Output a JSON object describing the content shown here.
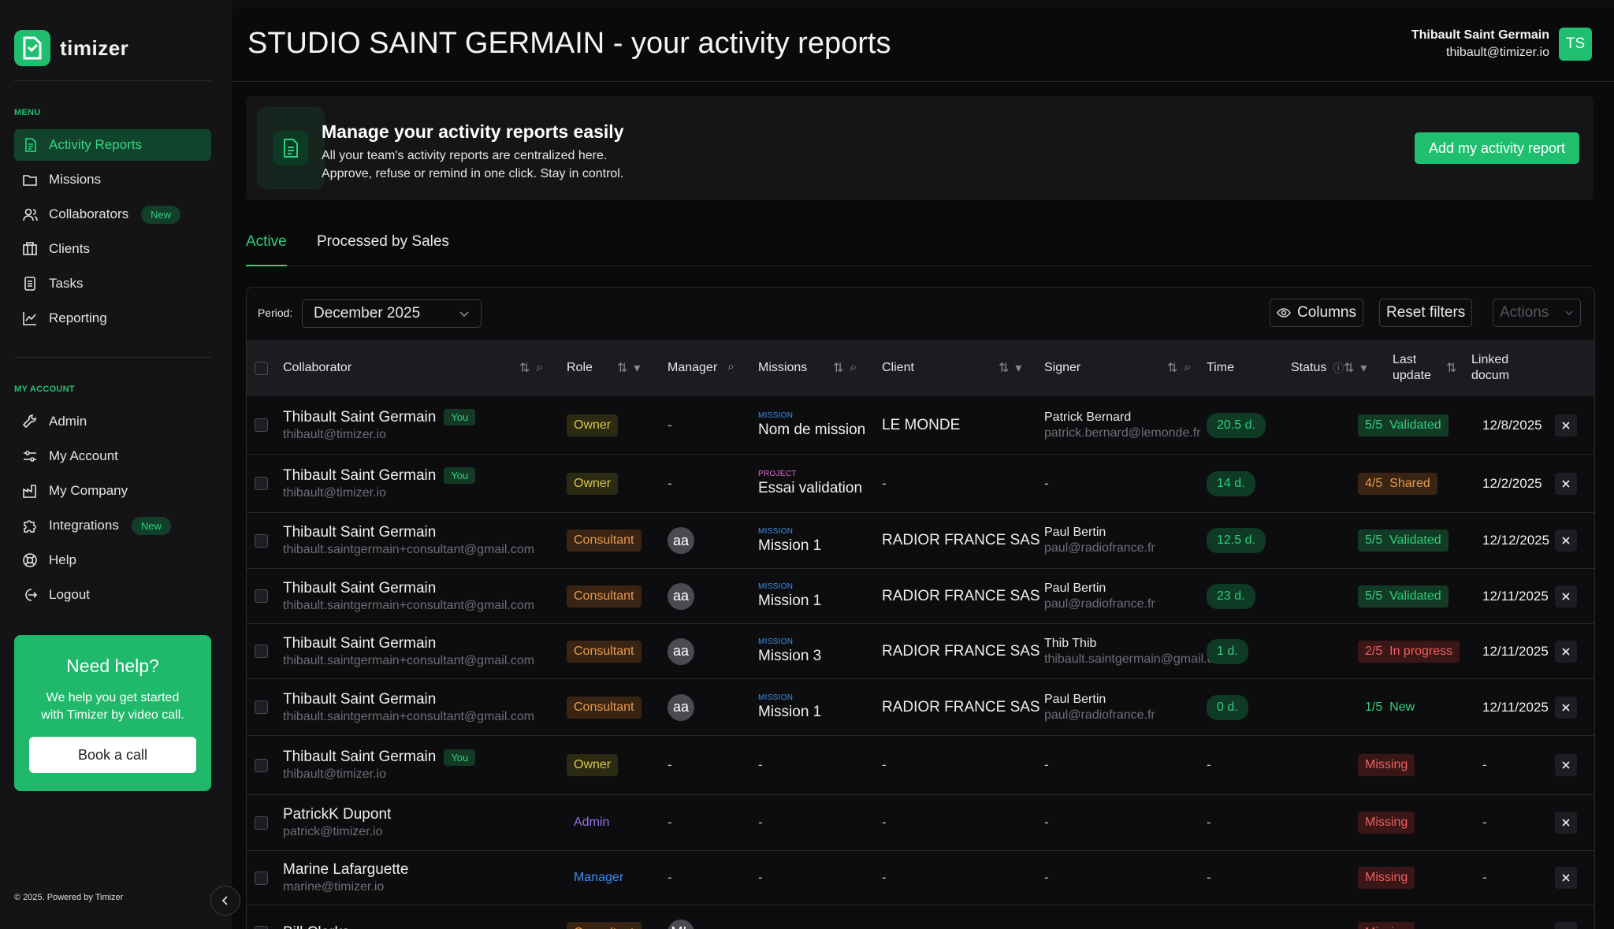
{
  "app": {
    "name": "timizer"
  },
  "sidebar": {
    "menu_label": "MENU",
    "menu": [
      {
        "label": "Activity Reports",
        "icon": "document-icon",
        "active": true,
        "badge": ""
      },
      {
        "label": "Missions",
        "icon": "folder-icon",
        "badge": ""
      },
      {
        "label": "Collaborators",
        "icon": "users-icon",
        "badge": "New"
      },
      {
        "label": "Clients",
        "icon": "building-icon",
        "badge": ""
      },
      {
        "label": "Tasks",
        "icon": "list-icon",
        "badge": ""
      },
      {
        "label": "Reporting",
        "icon": "chart-line-icon",
        "badge": ""
      }
    ],
    "account_label": "MY ACCOUNT",
    "account": [
      {
        "label": "Admin",
        "icon": "wrench-icon",
        "badge": ""
      },
      {
        "label": "My Account",
        "icon": "sliders-icon",
        "badge": ""
      },
      {
        "label": "My Company",
        "icon": "factory-icon",
        "badge": ""
      },
      {
        "label": "Integrations",
        "icon": "puzzle-icon",
        "badge": "New"
      },
      {
        "label": "Help",
        "icon": "lifebuoy-icon",
        "badge": ""
      },
      {
        "label": "Logout",
        "icon": "logout-icon",
        "badge": ""
      }
    ],
    "help_card": {
      "title": "Need help?",
      "text_line1": "We help you get started",
      "text_line2": "with Timizer by video call.",
      "button": "Book a call"
    },
    "footer": "© 2025. Powered by Timizer"
  },
  "header": {
    "title": "STUDIO SAINT GERMAIN - your activity reports",
    "user_name": "Thibault Saint Germain",
    "user_email": "thibault@timizer.io",
    "user_initials": "TS"
  },
  "banner": {
    "title": "Manage your activity reports easily",
    "line1": "All your team's activity reports are centralized here.",
    "line2": "Approve, refuse or remind in one click. Stay in control.",
    "button": "Add my activity report"
  },
  "tabs": [
    {
      "label": "Active",
      "active": true
    },
    {
      "label": "Processed by Sales",
      "active": false
    }
  ],
  "toolbar": {
    "period_label": "Period:",
    "period_value": "December 2025",
    "columns_label": "Columns",
    "reset_label": "Reset filters",
    "actions_label": "Actions"
  },
  "table": {
    "headers": {
      "collaborator": "Collaborator",
      "role": "Role",
      "manager": "Manager",
      "missions": "Missions",
      "client": "Client",
      "signer": "Signer",
      "time": "Time",
      "status": "Status",
      "last_update_1": "Last",
      "last_update_2": "update",
      "linked_1": "Linked",
      "linked_2": "docum"
    },
    "rows": [
      {
        "name": "Thibault Saint Germain",
        "you": "You",
        "email": "thibault@timizer.io",
        "role": "Owner",
        "role_type": "owner",
        "manager": "-",
        "mission_kind": "MISSION",
        "mission": "Nom de mission",
        "client": "LE MONDE",
        "signer": "Patrick Bernard",
        "signer_email": "patrick.bernard@lemonde.fr",
        "time": "20.5 d.",
        "status_count": "5/5",
        "status": "Validated",
        "status_type": "validated",
        "date": "12/8/2025"
      },
      {
        "name": "Thibault Saint Germain",
        "you": "You",
        "email": "thibault@timizer.io",
        "role": "Owner",
        "role_type": "owner",
        "manager": "-",
        "mission_kind": "PROJECT",
        "mission": "Essai validation",
        "client": "-",
        "signer": "-",
        "signer_email": "",
        "time": "14 d.",
        "status_count": "4/5",
        "status": "Shared",
        "status_type": "shared",
        "date": "12/2/2025"
      },
      {
        "name": "Thibault Saint Germain",
        "you": "",
        "email": "thibault.saintgermain+consultant@gmail.com",
        "role": "Consultant",
        "role_type": "consultant",
        "manager": "aa",
        "mission_kind": "MISSION",
        "mission": "Mission 1",
        "client": "RADIOR FRANCE SAS",
        "signer": "Paul Bertin",
        "signer_email": "paul@radiofrance.fr",
        "time": "12.5 d.",
        "status_count": "5/5",
        "status": "Validated",
        "status_type": "validated",
        "date": "12/12/2025"
      },
      {
        "name": "Thibault Saint Germain",
        "you": "",
        "email": "thibault.saintgermain+consultant@gmail.com",
        "role": "Consultant",
        "role_type": "consultant",
        "manager": "aa",
        "mission_kind": "MISSION",
        "mission": "Mission 1",
        "client": "RADIOR FRANCE SAS",
        "signer": "Paul Bertin",
        "signer_email": "paul@radiofrance.fr",
        "time": "23 d.",
        "status_count": "5/5",
        "status": "Validated",
        "status_type": "validated",
        "date": "12/11/2025"
      },
      {
        "name": "Thibault Saint Germain",
        "you": "",
        "email": "thibault.saintgermain+consultant@gmail.com",
        "role": "Consultant",
        "role_type": "consultant",
        "manager": "aa",
        "mission_kind": "MISSION",
        "mission": "Mission 3",
        "client": "RADIOR FRANCE SAS",
        "signer": "Thib Thib",
        "signer_email": "thibault.saintgermain@gmail.com",
        "time": "1 d.",
        "status_count": "2/5",
        "status": "In progress",
        "status_type": "inprogress",
        "date": "12/11/2025"
      },
      {
        "name": "Thibault Saint Germain",
        "you": "",
        "email": "thibault.saintgermain+consultant@gmail.com",
        "role": "Consultant",
        "role_type": "consultant",
        "manager": "aa",
        "mission_kind": "MISSION",
        "mission": "Mission 1",
        "client": "RADIOR FRANCE SAS",
        "signer": "Paul Bertin",
        "signer_email": "paul@radiofrance.fr",
        "time": "0 d.",
        "status_count": "1/5",
        "status": "New",
        "status_type": "new",
        "date": "12/11/2025"
      },
      {
        "name": "Thibault Saint Germain",
        "you": "You",
        "email": "thibault@timizer.io",
        "role": "Owner",
        "role_type": "owner",
        "manager": "-",
        "mission_kind": "",
        "mission": "-",
        "client": "-",
        "signer": "-",
        "signer_email": "",
        "time": "-",
        "status_count": "",
        "status": "Missing",
        "status_type": "missing",
        "date": "-"
      },
      {
        "name": "PatrickK Dupont",
        "you": "",
        "email": "patrick@timizer.io",
        "role": "Admin",
        "role_type": "admin",
        "manager": "-",
        "mission_kind": "",
        "mission": "-",
        "client": "-",
        "signer": "-",
        "signer_email": "",
        "time": "-",
        "status_count": "",
        "status": "Missing",
        "status_type": "missing",
        "date": "-"
      },
      {
        "name": "Marine Lafarguette",
        "you": "",
        "email": "marine@timizer.io",
        "role": "Manager",
        "role_type": "manager",
        "manager": "-",
        "mission_kind": "",
        "mission": "-",
        "client": "-",
        "signer": "-",
        "signer_email": "",
        "time": "-",
        "status_count": "",
        "status": "Missing",
        "status_type": "missing",
        "date": "-"
      },
      {
        "name": "Bill Clarks",
        "you": "",
        "email": "",
        "role": "Consultant",
        "role_type": "consultant",
        "manager": "ML",
        "mission_kind": "",
        "mission": "",
        "client": "",
        "signer": "",
        "signer_email": "",
        "time": "",
        "status_count": "",
        "status": "Missing",
        "status_type": "missing",
        "date": ""
      }
    ]
  },
  "colors": {
    "accent": "#1fbf6f",
    "background": "#0a0a0b",
    "sidebar": "#141417"
  }
}
